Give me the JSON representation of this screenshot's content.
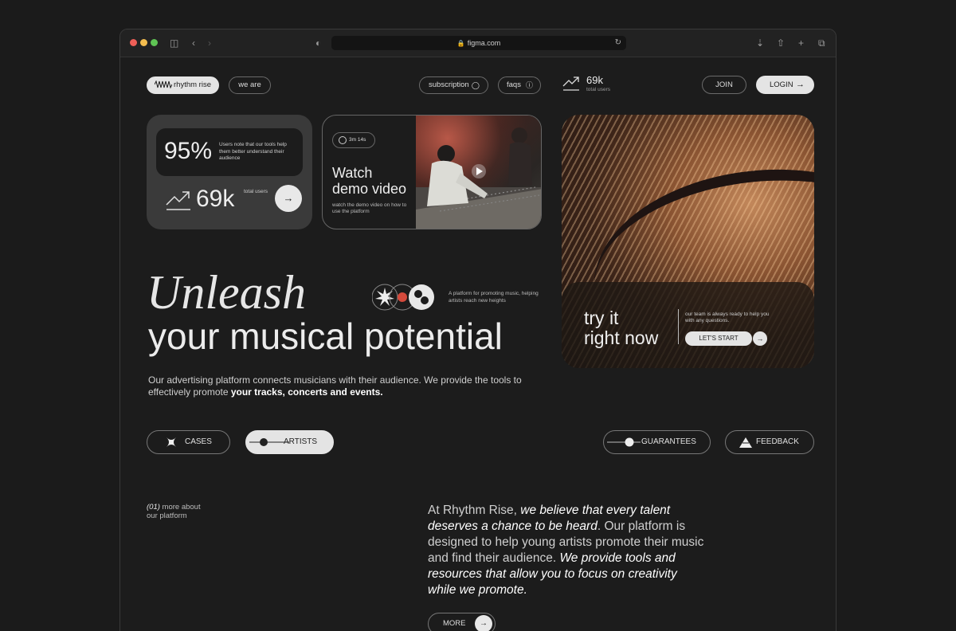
{
  "browser": {
    "url": "figma.com"
  },
  "header": {
    "logo_text": "rhythm rise",
    "we_are": "we are",
    "subscription": "subscription",
    "faqs": "faqs",
    "stat_value": "69k",
    "stat_label": "total users",
    "join": "JOIN",
    "login": "LOGIN"
  },
  "stats_card": {
    "percent": "95%",
    "percent_note": "Users note that our tools help them better understand their audience",
    "users": "69k",
    "users_label": "total users"
  },
  "video_card": {
    "duration": "3m 14s",
    "title_line1": "Watch",
    "title_line2": "demo video",
    "description": "watch the demo video on how to use the platform"
  },
  "hero": {
    "headline_serif": "Unleash",
    "headline_sans": "your musical potential",
    "tagline": "A platform for promoting music, helping artists reach new heights",
    "lead_text": "Our advertising platform connects musicians with their audience. We provide the tools to effectively promote ",
    "lead_bold": "your tracks, concerts and events."
  },
  "cta_card": {
    "line1": "try it",
    "line2": "right now",
    "team_note": "our team is always ready to help you with any questions.",
    "start": "LET'S START"
  },
  "categories": {
    "cases": "CASES",
    "artists": "ARTISTS",
    "guarantees": "GUARANTEES",
    "feedback": "FEEDBACK"
  },
  "about": {
    "index": "(01)",
    "label_rest": " more about",
    "label_line2": "our platform",
    "p1": "At Rhythm Rise, ",
    "p2": "we believe that every talent deserves a chance to be heard",
    "p3": ". Our platform is designed to help young artists promote their music and find their audience. ",
    "p4": "We provide tools and resources that allow you to focus on creativity while we promote.",
    "more": "MORE"
  }
}
